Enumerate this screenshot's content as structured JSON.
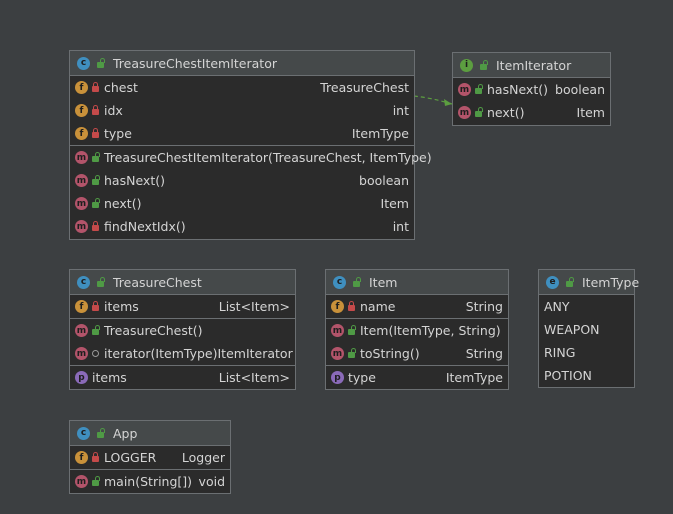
{
  "classes": {
    "tcii": {
      "name": "TreasureChestItemIterator",
      "fields": [
        {
          "name": "chest",
          "type": "TreasureChest"
        },
        {
          "name": "idx",
          "type": "int"
        },
        {
          "name": "type",
          "type": "ItemType"
        }
      ],
      "methods": [
        {
          "name": "TreasureChestItemIterator(TreasureChest, ItemType)",
          "type": ""
        },
        {
          "name": "hasNext()",
          "type": "boolean"
        },
        {
          "name": "next()",
          "type": "Item"
        },
        {
          "name": "findNextIdx()",
          "type": "int"
        }
      ]
    },
    "itemIterator": {
      "name": "ItemIterator",
      "methods": [
        {
          "name": "hasNext()",
          "type": "boolean"
        },
        {
          "name": "next()",
          "type": "Item"
        }
      ]
    },
    "treasureChest": {
      "name": "TreasureChest",
      "fields": [
        {
          "name": "items",
          "type": "List<Item>"
        }
      ],
      "methods": [
        {
          "name": "TreasureChest()",
          "type": ""
        },
        {
          "name": "iterator(ItemType)",
          "type": "ItemIterator"
        }
      ],
      "properties": [
        {
          "name": "items",
          "type": "List<Item>"
        }
      ]
    },
    "item": {
      "name": "Item",
      "fields": [
        {
          "name": "name",
          "type": "String"
        }
      ],
      "methods": [
        {
          "name": "Item(ItemType, String)",
          "type": ""
        },
        {
          "name": "toString()",
          "type": "String"
        }
      ],
      "properties": [
        {
          "name": "type",
          "type": "ItemType"
        }
      ]
    },
    "itemType": {
      "name": "ItemType",
      "constants": [
        "ANY",
        "WEAPON",
        "RING",
        "POTION"
      ]
    },
    "app": {
      "name": "App",
      "fields": [
        {
          "name": "LOGGER",
          "type": "Logger"
        }
      ],
      "methods": [
        {
          "name": "main(String[])",
          "type": "void"
        }
      ]
    }
  },
  "kind_letters": {
    "class": "c",
    "interface": "i",
    "field": "f",
    "method": "m",
    "property": "p",
    "enum": "e"
  },
  "colors": {
    "background": "#3c3f41",
    "box": "#2b2b2b",
    "header": "#45494a",
    "arrow": "#5c9e40"
  }
}
